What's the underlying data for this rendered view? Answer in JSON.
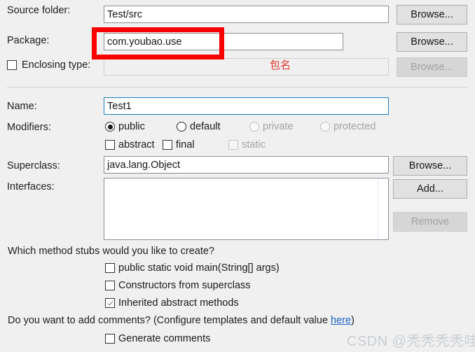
{
  "dialog": {
    "rows": {
      "source_folder": {
        "label": "Source folder:",
        "value": "Test/src",
        "button": "Browse..."
      },
      "package": {
        "label": "Package:",
        "value": "com.youbao.use",
        "button": "Browse..."
      },
      "enclosing_type": {
        "label": "Enclosing type:",
        "value": "",
        "button": "Browse...",
        "checked": false
      },
      "name": {
        "label": "Name:",
        "value": "Test1"
      },
      "modifiers": {
        "label": "Modifiers:",
        "radios": [
          {
            "label": "public",
            "selected": true,
            "disabled": false
          },
          {
            "label": "default",
            "selected": false,
            "disabled": false
          },
          {
            "label": "private",
            "selected": false,
            "disabled": true
          },
          {
            "label": "protected",
            "selected": false,
            "disabled": true
          }
        ],
        "checkboxes": [
          {
            "label": "abstract",
            "checked": false,
            "disabled": false
          },
          {
            "label": "final",
            "checked": false,
            "disabled": false
          },
          {
            "label": "static",
            "checked": false,
            "disabled": true
          }
        ]
      },
      "superclass": {
        "label": "Superclass:",
        "value": "java.lang.Object",
        "button": "Browse..."
      },
      "interfaces": {
        "label": "Interfaces:",
        "items": [],
        "add_button": "Add...",
        "remove_button": "Remove"
      }
    },
    "stubs": {
      "question": "Which method stubs would you like to create?",
      "options": [
        {
          "label": "public static void main(String[] args)",
          "checked": false
        },
        {
          "label": "Constructors from superclass",
          "checked": false
        },
        {
          "label": "Inherited abstract methods",
          "checked": true
        }
      ]
    },
    "comments": {
      "question_prefix": "Do you want to add comments? (Configure templates and default value ",
      "link_text": "here",
      "question_suffix": ")",
      "option": {
        "label": "Generate comments",
        "checked": false
      }
    }
  },
  "annotations": {
    "package_note": "包名",
    "red_box_color": "#fc0000"
  },
  "watermark": {
    "text": "CSDN @秃秃秃秃哇"
  }
}
